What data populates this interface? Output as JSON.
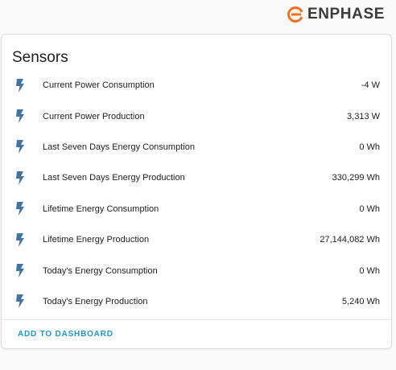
{
  "brand": {
    "name": "ENPHASE",
    "logo_color": "#f36f21"
  },
  "card": {
    "title": "Sensors",
    "action_label": "ADD TO DASHBOARD",
    "icon": "flash-icon",
    "icon_color": "#44739e",
    "rows": [
      {
        "name": "Current Power Consumption",
        "value": "-4 W"
      },
      {
        "name": "Current Power Production",
        "value": "3,313 W"
      },
      {
        "name": "Last Seven Days Energy Consumption",
        "value": "0 Wh"
      },
      {
        "name": "Last Seven Days Energy Production",
        "value": "330,299 Wh"
      },
      {
        "name": "Lifetime Energy Consumption",
        "value": "0 Wh"
      },
      {
        "name": "Lifetime Energy Production",
        "value": "27,144,082 Wh"
      },
      {
        "name": "Today's Energy Consumption",
        "value": "0 Wh"
      },
      {
        "name": "Today's Energy Production",
        "value": "5,240 Wh"
      }
    ]
  }
}
